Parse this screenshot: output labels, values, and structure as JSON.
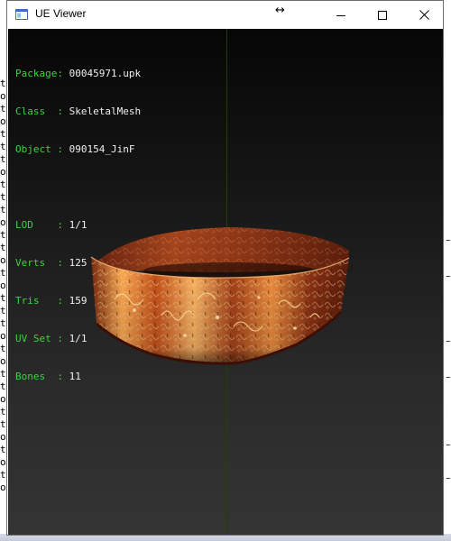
{
  "window": {
    "title": "UE Viewer",
    "controls": {
      "minimize": "minimize",
      "maximize": "maximize",
      "close": "close"
    }
  },
  "background": {
    "terminal_chars": [
      "t",
      "o",
      "t",
      "o",
      "t",
      "t",
      "t",
      "o",
      "t",
      "t",
      "t",
      "o",
      "t",
      "t",
      "o",
      "t",
      "o",
      "t",
      "t",
      "t",
      "o",
      "t",
      "o",
      "t",
      "t",
      "o",
      "t",
      "t",
      "o",
      "t",
      "o",
      "t",
      "o"
    ]
  },
  "info": {
    "package": {
      "key": "Package:",
      "value": "00045971.upk"
    },
    "class": {
      "key": "Class  :",
      "value": "SkeletalMesh"
    },
    "object": {
      "key": "Object :",
      "value": "090154_JinF"
    },
    "lod": {
      "key": "LOD    :",
      "value": "1/1"
    },
    "verts": {
      "key": "Verts  :",
      "value": "125"
    },
    "tris": {
      "key": "Tris   :",
      "value": "159"
    },
    "uvset": {
      "key": "UV Set :",
      "value": "1/1"
    },
    "bones": {
      "key": "Bones  :",
      "value": "11"
    }
  },
  "colors": {
    "info_key": "#3fd23f",
    "info_value": "#f0f0f0",
    "axis": "#1c1ccc",
    "mesh_glow": "#ffb050",
    "mesh_dark": "#4a1406"
  }
}
